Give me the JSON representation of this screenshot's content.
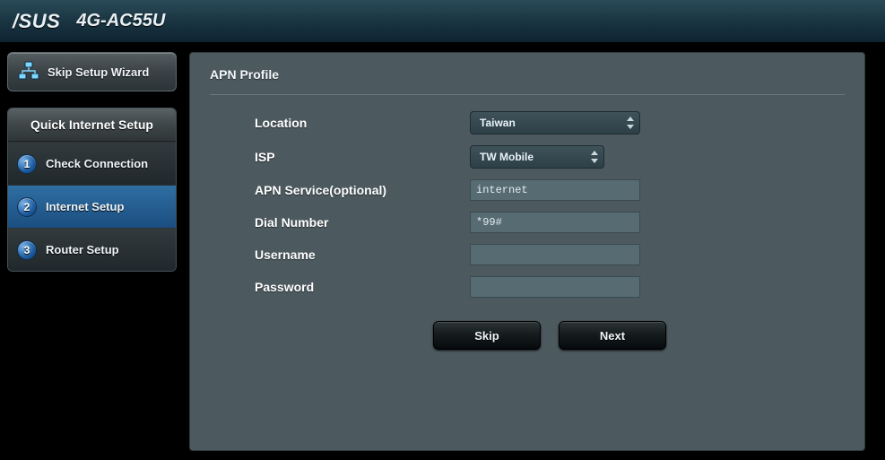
{
  "header": {
    "brand": "/SUS",
    "model": "4G-AC55U"
  },
  "sidebar": {
    "skip_label": "Skip Setup Wizard",
    "box_title": "Quick Internet Setup",
    "steps": [
      {
        "num": "1",
        "label": "Check Connection"
      },
      {
        "num": "2",
        "label": "Internet Setup"
      },
      {
        "num": "3",
        "label": "Router Setup"
      }
    ],
    "active_index": 1
  },
  "panel": {
    "title": "APN Profile",
    "labels": {
      "location": "Location",
      "isp": "ISP",
      "apn": "APN Service(optional)",
      "dial": "Dial Number",
      "user": "Username",
      "pass": "Password"
    },
    "values": {
      "location": "Taiwan",
      "isp": "TW Mobile",
      "apn": "internet",
      "dial": "*99#",
      "user": "",
      "pass": ""
    },
    "buttons": {
      "skip": "Skip",
      "next": "Next"
    }
  }
}
